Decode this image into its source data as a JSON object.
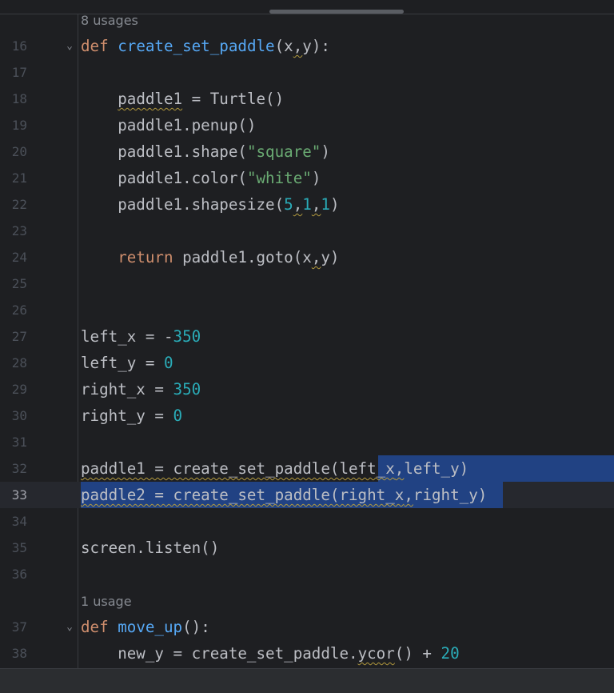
{
  "usage_hints": {
    "create_set_paddle": "8 usages",
    "move_up": "1 usage"
  },
  "lines": [
    {
      "num": "16",
      "fold": "⌄",
      "tokens": [
        {
          "t": "def",
          "c": "kw"
        },
        {
          "t": " "
        },
        {
          "t": "create_set_paddle",
          "c": "fn"
        },
        {
          "t": "(x"
        },
        {
          "t": ",",
          "w": true
        },
        {
          "t": "y):"
        }
      ]
    },
    {
      "num": "17",
      "tokens": []
    },
    {
      "num": "18",
      "tokens": [
        {
          "t": "    "
        },
        {
          "t": "paddle1",
          "w": true
        },
        {
          "t": " = Turtle()"
        }
      ]
    },
    {
      "num": "19",
      "tokens": [
        {
          "t": "    paddle1.penup()"
        }
      ]
    },
    {
      "num": "20",
      "tokens": [
        {
          "t": "    paddle1.shape("
        },
        {
          "t": "\"square\"",
          "c": "str"
        },
        {
          "t": ")"
        }
      ]
    },
    {
      "num": "21",
      "tokens": [
        {
          "t": "    paddle1.color("
        },
        {
          "t": "\"white\"",
          "c": "str"
        },
        {
          "t": ")"
        }
      ]
    },
    {
      "num": "22",
      "tokens": [
        {
          "t": "    paddle1.shapesize("
        },
        {
          "t": "5",
          "c": "num"
        },
        {
          "t": ",",
          "w": true
        },
        {
          "t": "1",
          "c": "num"
        },
        {
          "t": ",",
          "w": true
        },
        {
          "t": "1",
          "c": "num"
        },
        {
          "t": ")"
        }
      ]
    },
    {
      "num": "23",
      "tokens": []
    },
    {
      "num": "24",
      "tokens": [
        {
          "t": "    "
        },
        {
          "t": "return",
          "c": "kw"
        },
        {
          "t": " paddle1.goto(x"
        },
        {
          "t": ",",
          "w": true
        },
        {
          "t": "y)"
        }
      ]
    },
    {
      "num": "25",
      "tokens": []
    },
    {
      "num": "26",
      "tokens": []
    },
    {
      "num": "27",
      "tokens": [
        {
          "t": "left_x = -"
        },
        {
          "t": "350",
          "c": "num"
        }
      ]
    },
    {
      "num": "28",
      "tokens": [
        {
          "t": "left_y = "
        },
        {
          "t": "0",
          "c": "num"
        }
      ]
    },
    {
      "num": "29",
      "tokens": [
        {
          "t": "right_x = "
        },
        {
          "t": "350",
          "c": "num"
        }
      ]
    },
    {
      "num": "30",
      "tokens": [
        {
          "t": "right_y = "
        },
        {
          "t": "0",
          "c": "num"
        }
      ]
    },
    {
      "num": "31",
      "tokens": []
    },
    {
      "num": "32",
      "sel": "tail",
      "tokens": [
        {
          "t": "paddle1 = create_set_paddle(left_x",
          "w": true
        },
        {
          "t": ",",
          "w": true
        },
        {
          "t": "left_y)"
        }
      ]
    },
    {
      "num": "33",
      "current": true,
      "sel": "full",
      "tokens": [
        {
          "t": "paddle2 = create_set_paddle(right_x",
          "w": true
        },
        {
          "t": ",",
          "w": true
        },
        {
          "t": "right_y)"
        }
      ]
    },
    {
      "num": "34",
      "tokens": []
    },
    {
      "num": "35",
      "tokens": [
        {
          "t": "screen.listen()"
        }
      ]
    },
    {
      "num": "36",
      "tokens": []
    },
    {
      "num": "37",
      "fold": "⌄",
      "tokens": [
        {
          "t": "def",
          "c": "kw"
        },
        {
          "t": " "
        },
        {
          "t": "move_up",
          "c": "fn"
        },
        {
          "t": "():"
        }
      ]
    },
    {
      "num": "38",
      "tokens": [
        {
          "t": "    new_y = create_set_paddle."
        },
        {
          "t": "ycor",
          "w": true
        },
        {
          "t": "() + "
        },
        {
          "t": "20",
          "c": "num"
        }
      ]
    }
  ]
}
